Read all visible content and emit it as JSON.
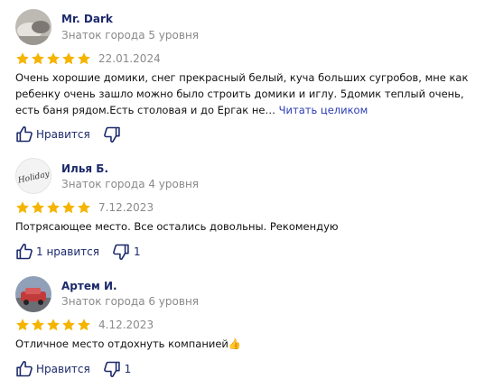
{
  "colors": {
    "star": "#f5b400",
    "link": "#2a3bb5",
    "author": "#1c2a6b",
    "muted": "#8a8a8a"
  },
  "reviews": [
    {
      "author": "Mr. Dark",
      "level": "Знаток города 5 уровня",
      "rating": 5,
      "date": "22.01.2024",
      "text": "Очень хорошие домики, снег прекрасный белый, куча больших сугробов, мне как ребенку очень зашло можно было строить домики и иглу. 5домик теплый очень, есть баня рядом.Есть столовая и до Ергак не…",
      "more": "Читать целиком",
      "like_label": "Нравится",
      "dislike_count": ""
    },
    {
      "author": "Илья Б.",
      "level": "Знаток города 4 уровня",
      "rating": 5,
      "date": "7.12.2023",
      "text": "Потрясающее место. Все остались довольны. Рекомендую",
      "like_label": "1 нравится",
      "dislike_count": "1",
      "avatar_text": "Holiday"
    },
    {
      "author": "Артем И.",
      "level": "Знаток города 6 уровня",
      "rating": 5,
      "date": "4.12.2023",
      "text": "Отличное место отдохнуть компанией👍",
      "like_label": "Нравится",
      "dislike_count": "1"
    }
  ]
}
